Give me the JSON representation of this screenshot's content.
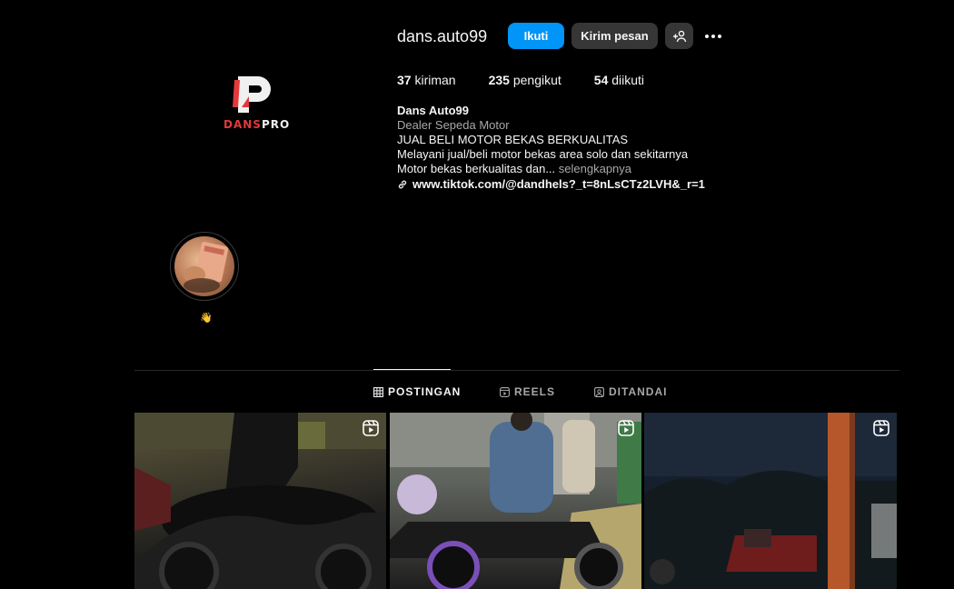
{
  "profile": {
    "username": "dans.auto99",
    "logo_text_red": "DANS",
    "logo_text_white": "PRO",
    "follow_label": "Ikuti",
    "message_label": "Kirim pesan"
  },
  "stats": {
    "posts_count": "37",
    "posts_label": "kiriman",
    "followers_count": "235",
    "followers_label": "pengikut",
    "following_count": "54",
    "following_label": "diikuti"
  },
  "bio": {
    "name": "Dans Auto99",
    "category": "Dealer Sepeda Motor",
    "line1": "JUAL BELI MOTOR BEKAS BERKUALITAS",
    "line2": "Melayani jual/beli motor bekas area solo dan sekitarnya",
    "line3": "Motor bekas berkualitas dan...",
    "more": "selengkapnya",
    "link": "www.tiktok.com/@dandhels?_t=8nLsCTz2LVH&_r=1"
  },
  "highlight": {
    "label": "👋"
  },
  "tabs": [
    {
      "label": "POSTINGAN",
      "icon": "grid-icon",
      "active": true
    },
    {
      "label": "REELS",
      "icon": "reels-icon",
      "active": false
    },
    {
      "label": "DITANDAI",
      "icon": "tagged-icon",
      "active": false
    }
  ],
  "colors": {
    "background": "#000000",
    "follow_button": "#0095f6",
    "secondary_button": "#363636",
    "muted_text": "#a8a8a8",
    "brand_red": "#e23a3a"
  }
}
